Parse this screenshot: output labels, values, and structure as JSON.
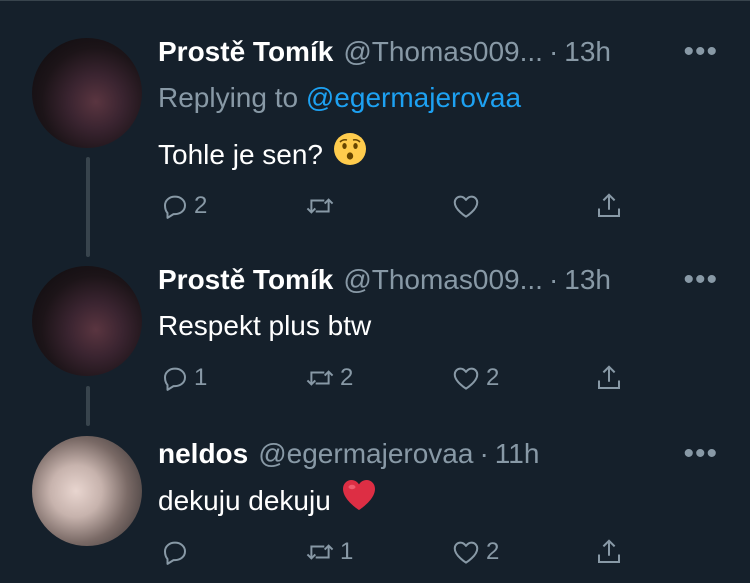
{
  "tweets": [
    {
      "name": "Prostě Tomík",
      "handle": "@Thomas009...",
      "dot": "·",
      "time": "13h",
      "replying_prefix": "Replying to",
      "replying_to": "@egermajerovaa",
      "text": "Tohle je sen?",
      "emoji": "hushed-face",
      "reply_count": "2",
      "retweet_count": "",
      "like_count": ""
    },
    {
      "name": "Prostě Tomík",
      "handle": "@Thomas009...",
      "dot": "·",
      "time": "13h",
      "text": "Respekt plus btw",
      "reply_count": "1",
      "retweet_count": "2",
      "like_count": "2"
    },
    {
      "name": "neldos",
      "handle": "@egermajerovaa",
      "dot": "·",
      "time": "11h",
      "text": "dekuju dekuju",
      "emoji": "red-heart",
      "reply_count": "",
      "retweet_count": "1",
      "like_count": "2"
    }
  ],
  "more_label": "•••",
  "colors": {
    "background": "#15202b",
    "primary_text": "#ffffff",
    "secondary_text": "#8899a6",
    "accent": "#1da1f2",
    "divider": "#38444d"
  }
}
